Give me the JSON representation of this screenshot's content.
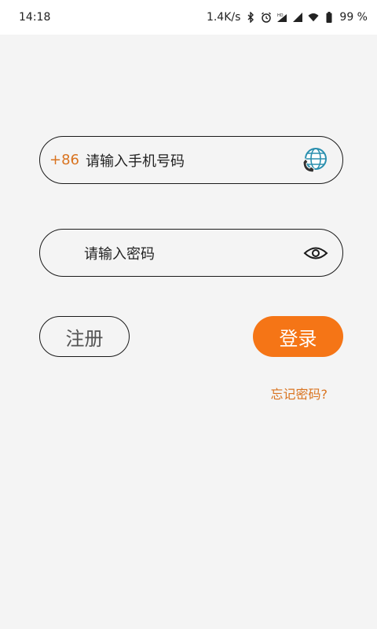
{
  "status_bar": {
    "time": "14:18",
    "net_speed": "1.4K/s",
    "battery": "99 %",
    "icons": [
      "bluetooth-icon",
      "alarm-icon",
      "hd-signal-icon",
      "signal-icon",
      "wifi-icon",
      "battery-icon"
    ]
  },
  "login": {
    "country_code": "+86",
    "phone_placeholder": "请输入手机号码",
    "password_placeholder": "请输入密码",
    "register_label": "注册",
    "login_label": "登录",
    "forgot_label": "忘记密码?"
  },
  "colors": {
    "accent": "#f57516",
    "accent_text": "#d9731f",
    "background": "#f4f4f4"
  }
}
